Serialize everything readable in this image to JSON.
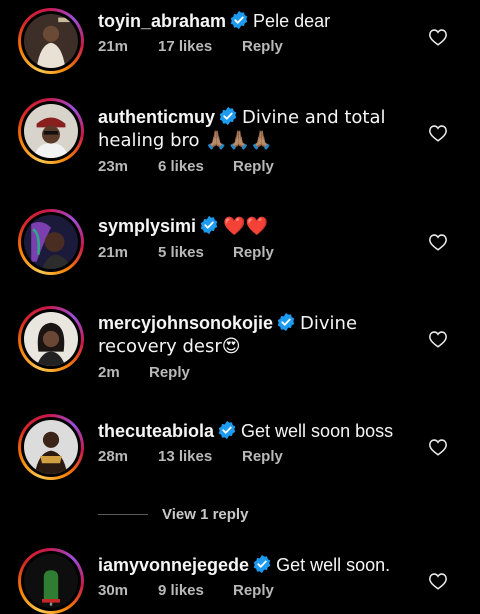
{
  "comments": [
    {
      "username": "toyin_abraham",
      "text": "Pele dear",
      "time": "21m",
      "likes": "17 likes",
      "reply": "Reply",
      "avatar": "avatar-toyin"
    },
    {
      "username": "authenticmuy",
      "text": "Divine and total healing bro 🙏🏽🙏🏽🙏🏽",
      "time": "23m",
      "likes": "6 likes",
      "reply": "Reply",
      "avatar": "avatar-authentic"
    },
    {
      "username": "symplysimi",
      "text": "❤️❤️",
      "time": "21m",
      "likes": "5 likes",
      "reply": "Reply",
      "avatar": "avatar-simi"
    },
    {
      "username": "mercyjohnsonokojie",
      "text": "Divine recovery desr😍",
      "time": "2m",
      "likes": "",
      "reply": "Reply",
      "avatar": "avatar-mercy"
    },
    {
      "username": "thecuteabiola",
      "text": "Get well soon boss",
      "time": "28m",
      "likes": "13 likes",
      "reply": "Reply",
      "avatar": "avatar-abiola"
    },
    {
      "username": "iamyvonnejegede",
      "text": "Get well soon.",
      "time": "30m",
      "likes": "9 likes",
      "reply": "Reply",
      "avatar": "avatar-yvonne"
    }
  ],
  "view_replies": "View 1 reply",
  "icons": {
    "verified": "verified-badge-icon",
    "like": "heart-outline-icon"
  },
  "colors": {
    "background": "#000000",
    "verified": "#1d9bf0",
    "meta": "#b9b9b9"
  }
}
